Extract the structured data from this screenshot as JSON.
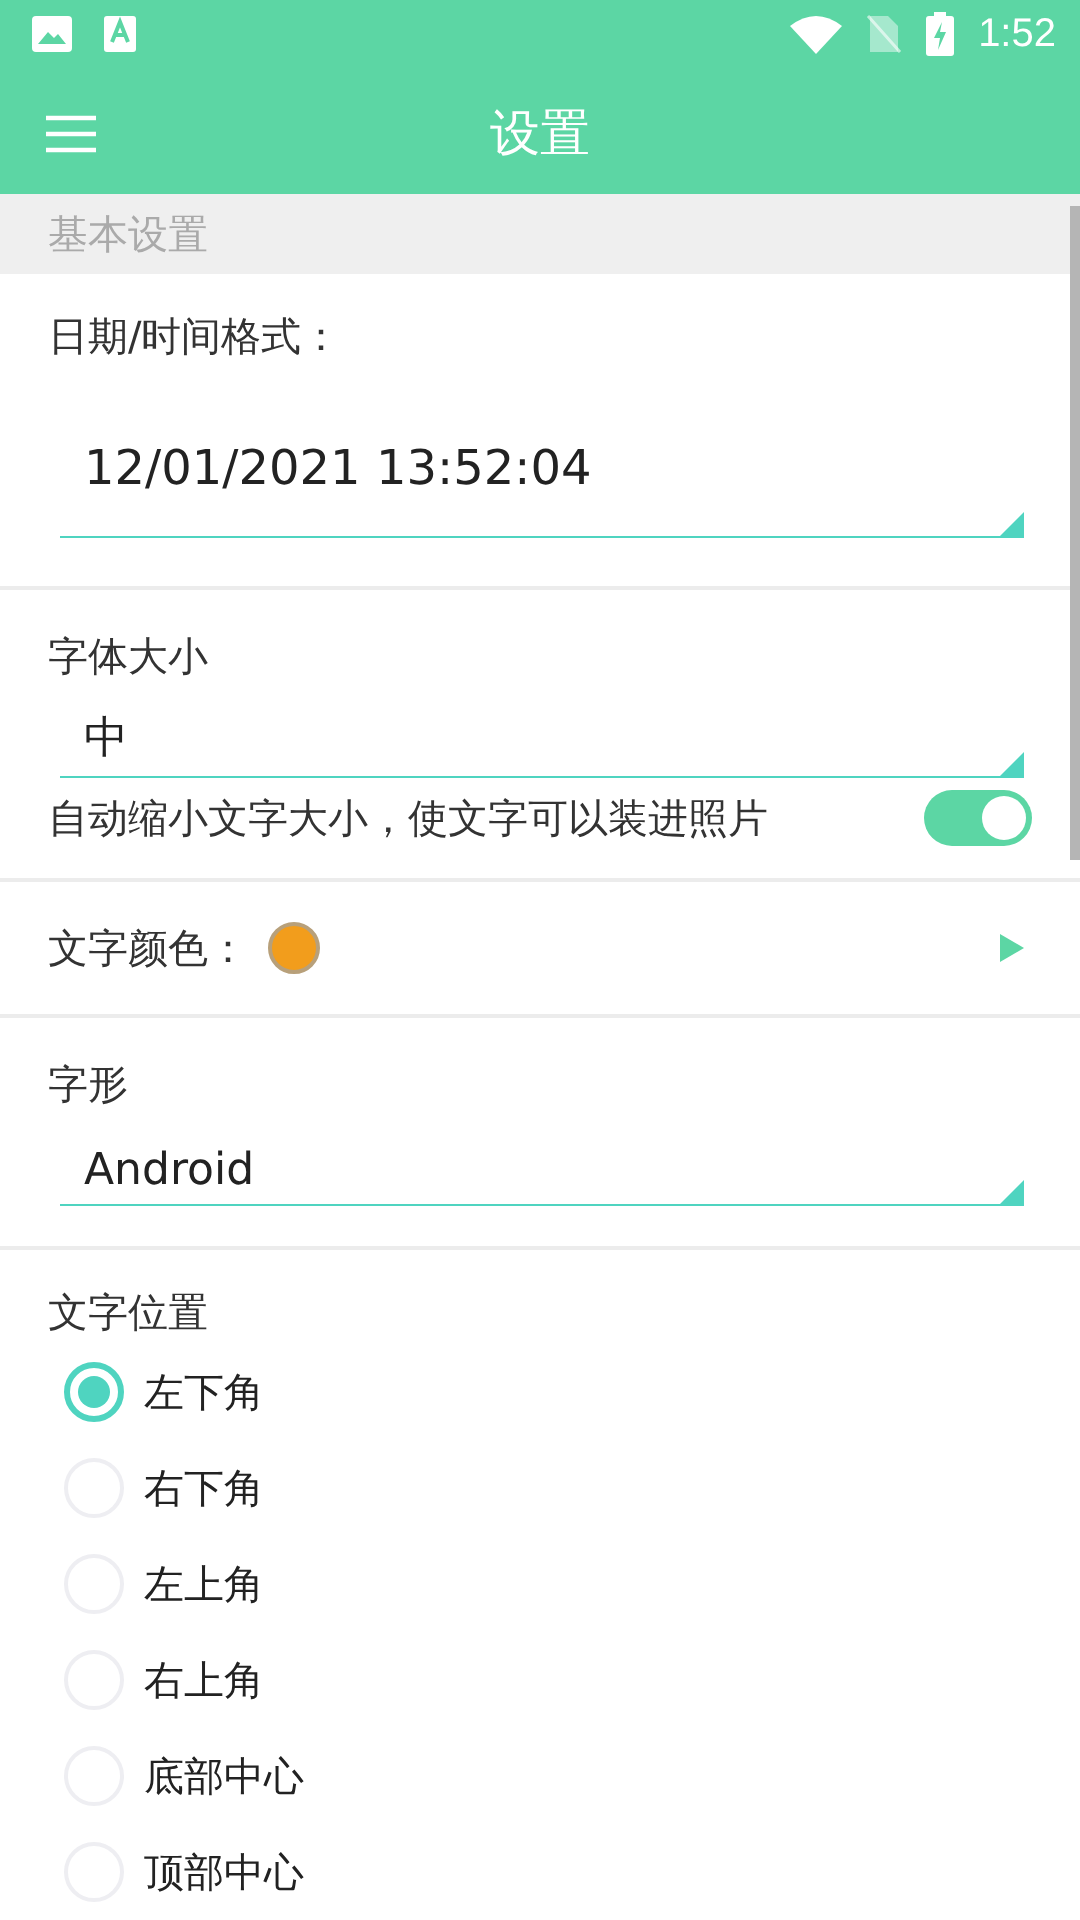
{
  "status_bar": {
    "time": "1:52"
  },
  "app_bar": {
    "title": "设置"
  },
  "sections": [
    {
      "kind": "header",
      "label": "基本设置"
    },
    {
      "kind": "spinner",
      "label": "日期/时间格式：",
      "value": "12/01/2021 13:52:04"
    },
    {
      "kind": "spinner",
      "label": "字体大小",
      "value": "中",
      "toggle": {
        "label": "自动缩小文字大小，使文字可以装进照片",
        "on": true
      }
    },
    {
      "kind": "color",
      "label": "文字颜色：",
      "color": "#f29d1c"
    },
    {
      "kind": "spinner",
      "label": "字形",
      "value": "Android"
    },
    {
      "kind": "radio",
      "label": "文字位置",
      "options": [
        {
          "label": "左下角",
          "selected": true
        },
        {
          "label": "右下角",
          "selected": false
        },
        {
          "label": "左上角",
          "selected": false
        },
        {
          "label": "右上角",
          "selected": false
        },
        {
          "label": "底部中心",
          "selected": false
        },
        {
          "label": "顶部中心",
          "selected": false
        }
      ]
    }
  ]
}
